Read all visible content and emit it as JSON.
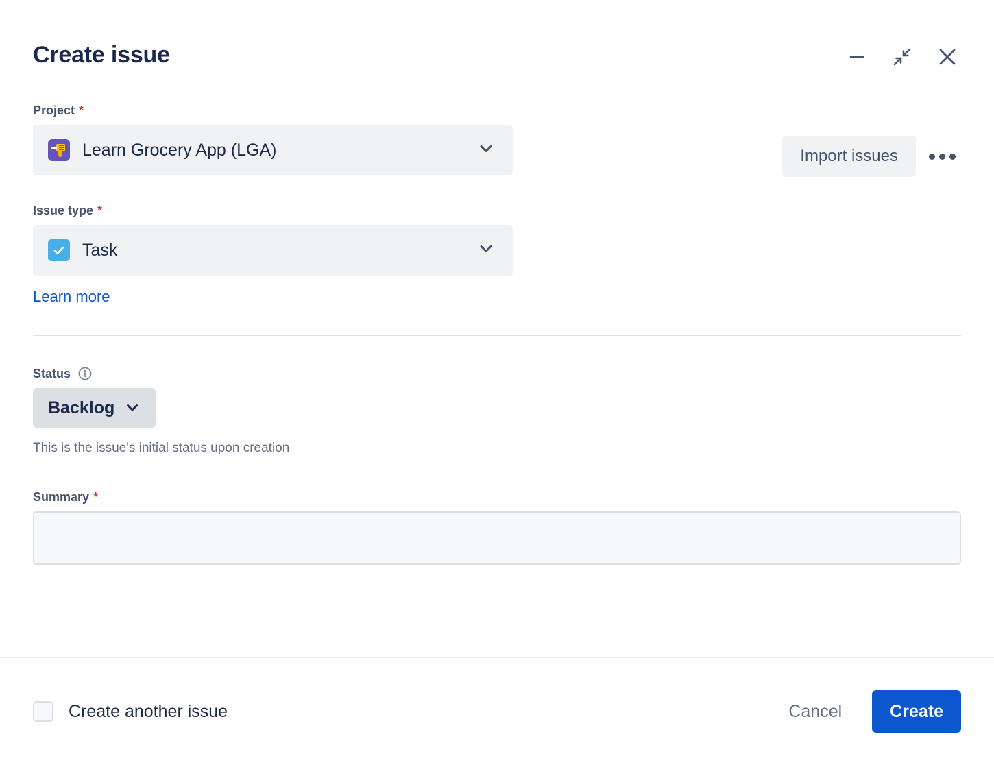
{
  "dialog": {
    "title": "Create issue",
    "window_controls": [
      {
        "name": "minimize",
        "label": "Minimize"
      },
      {
        "name": "shrink",
        "label": "Shrink"
      },
      {
        "name": "close",
        "label": "Close"
      }
    ]
  },
  "toolbar": {
    "import_issues_label": "Import issues",
    "more_actions_label": "More actions"
  },
  "form": {
    "project": {
      "label": "Project",
      "required": "*",
      "value": "Learn Grocery App (LGA)",
      "avatar_icon": "project-avatar-drill-icon"
    },
    "issue_type": {
      "label": "Issue type",
      "required": "*",
      "value": "Task",
      "type_icon": "task-check-icon",
      "learn_more_label": "Learn more"
    },
    "status": {
      "label": "Status",
      "info_icon": "info-circle-icon",
      "value": "Backlog",
      "helper_text": "This is the issue's initial status upon creation"
    },
    "summary": {
      "label": "Summary",
      "required": "*",
      "value": "",
      "placeholder": ""
    }
  },
  "footer": {
    "create_another_label": "Create another issue",
    "create_another_checked": false,
    "cancel_label": "Cancel",
    "create_label": "Create"
  },
  "colors": {
    "primary_button": "#0c56d0",
    "link": "#0c56d0",
    "required_asterisk": "#c9372c",
    "project_avatar_bg": "#6554c0",
    "task_icon_bg": "#4bade8",
    "field_bg": "#f1f2f4",
    "status_lozenge_bg": "#dcdfe4",
    "title_text": "#1b2a4b",
    "label_text": "#44546f"
  }
}
